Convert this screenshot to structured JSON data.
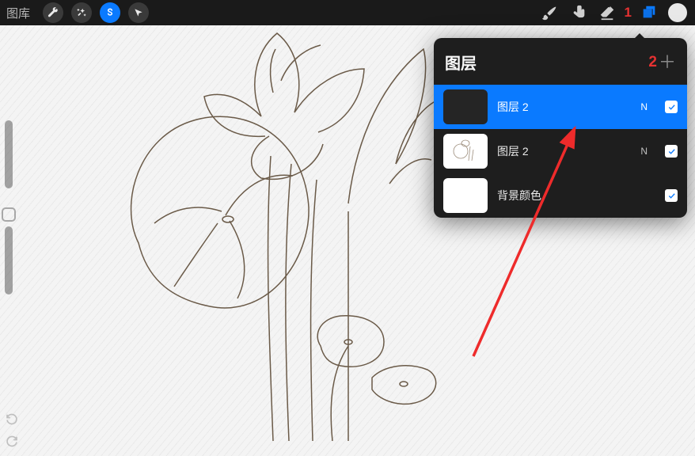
{
  "toolbar": {
    "gallery_label": "图库",
    "marker_1": "1"
  },
  "layers_panel": {
    "title": "图层",
    "count_marker": "2",
    "add_glyph": "＋",
    "rows": [
      {
        "name": "图层 2",
        "mode": "N"
      },
      {
        "name": "图层 2",
        "mode": "N"
      },
      {
        "name": "背景颜色",
        "mode": ""
      }
    ]
  }
}
